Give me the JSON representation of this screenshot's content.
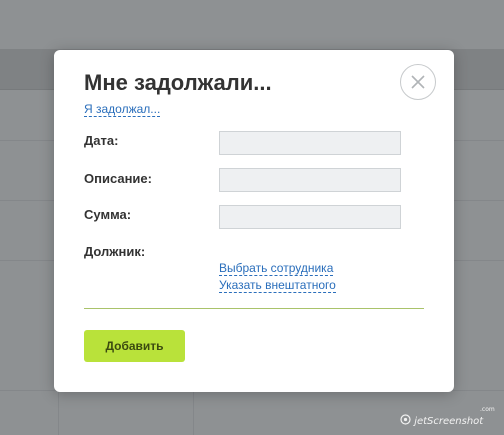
{
  "dialog": {
    "title": "Мне задолжали...",
    "switch_link": "Я задолжал...",
    "close_icon": "close-icon"
  },
  "form": {
    "date": {
      "label": "Дата:",
      "value": ""
    },
    "description": {
      "label": "Описание:",
      "value": ""
    },
    "amount": {
      "label": "Сумма:",
      "value": ""
    },
    "debtor": {
      "label": "Должник:",
      "choose_employee": "Выбрать сотрудника",
      "specify_external": "Указать внештатного"
    },
    "submit_label": "Добавить"
  },
  "watermark": {
    "text": "jetScreenshot",
    "suffix": ".com"
  },
  "colors": {
    "accent": "#b9e23a",
    "link": "#2a6ebb",
    "divider": "#a9c36a",
    "overlay": "#8e9193"
  }
}
